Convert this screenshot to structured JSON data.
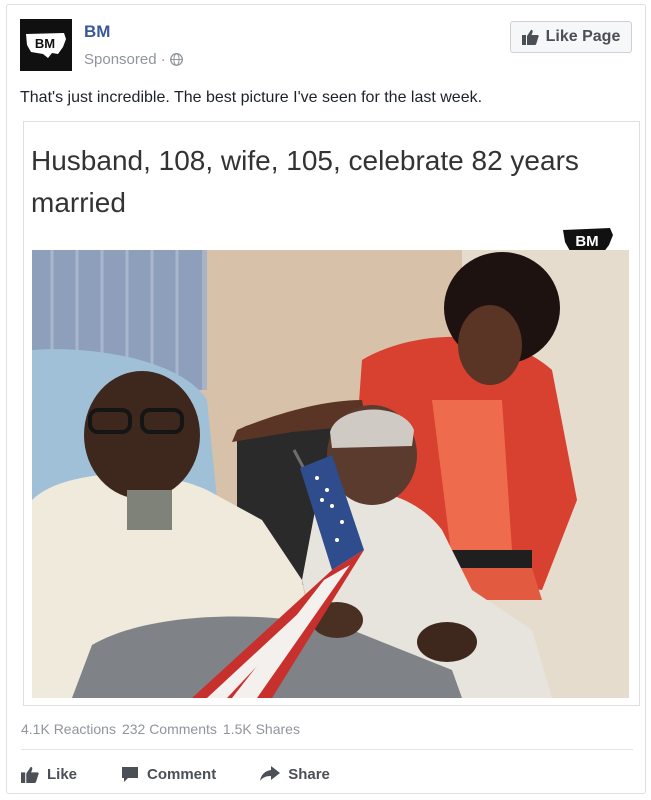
{
  "page": {
    "name": "BM",
    "sponsored_label": "Sponsored",
    "logo_text": "BM",
    "like_page_label": "Like Page"
  },
  "post": {
    "text": "That's just incredible. The best picture I've seen for the last week.",
    "headline": "Husband, 108, wife, 105, celebrate 82 years married",
    "watermark_text": "BM"
  },
  "stats": {
    "reactions": "4.1K Reactions",
    "comments": "232 Comments",
    "shares": "1.5K Shares"
  },
  "actions": {
    "like": "Like",
    "comment": "Comment",
    "share": "Share"
  },
  "colors": {
    "brand": "#3b5998",
    "muted": "#90949c",
    "action_text": "#4b4f56"
  },
  "icons": [
    "bm-logo-icon",
    "globe-icon",
    "thumbs-up-icon",
    "comment-icon",
    "share-arrow-icon"
  ]
}
